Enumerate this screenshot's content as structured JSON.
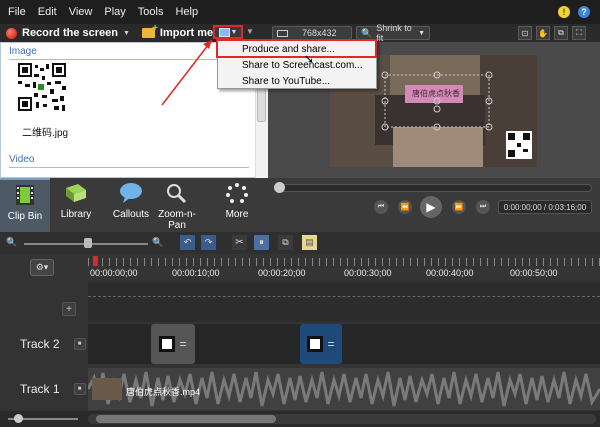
{
  "menu": {
    "items": [
      "File",
      "Edit",
      "View",
      "Play",
      "Tools",
      "Help"
    ],
    "bulb_icon": "lightbulb-icon",
    "help_icon": "?"
  },
  "toolbar": {
    "record_label": "Record the screen",
    "import_label": "Import media",
    "produce_icon": "produce-share-icon"
  },
  "preview": {
    "dimensions": "768x432",
    "zoom": "Shrink to fit"
  },
  "clip_bin": {
    "image_header": "Image",
    "image_filename": "二维码.jpg",
    "video_header": "Video"
  },
  "dropdown": {
    "items": [
      "Produce and share...",
      "Share to Screencast.com...",
      "Share to YouTube..."
    ]
  },
  "video_overlay": {
    "sign_text": "唐伯虎点秋香"
  },
  "tabs": [
    {
      "label": "Clip Bin"
    },
    {
      "label": "Library"
    },
    {
      "label": "Callouts"
    },
    {
      "label": "Zoom-n-\nPan"
    },
    {
      "label": "More"
    }
  ],
  "player": {
    "time": "0:00:00;00 / 0:03:16;00",
    "progress": 0.0
  },
  "timeline": {
    "ticks": [
      "00:00:00;00",
      "00:00:10;00",
      "00:00:20;00",
      "00:00:30;00",
      "00:00:40;00",
      "00:00:50;00"
    ],
    "tracks": [
      {
        "label": "Track 2"
      },
      {
        "label": "Track 1"
      }
    ],
    "clip_track1": "唐伯虎点秋香.mp4"
  },
  "colors": {
    "highlight_red": "#e0282a",
    "selected_clip": "#1e4a7a",
    "playhead": "#d72a2a"
  }
}
